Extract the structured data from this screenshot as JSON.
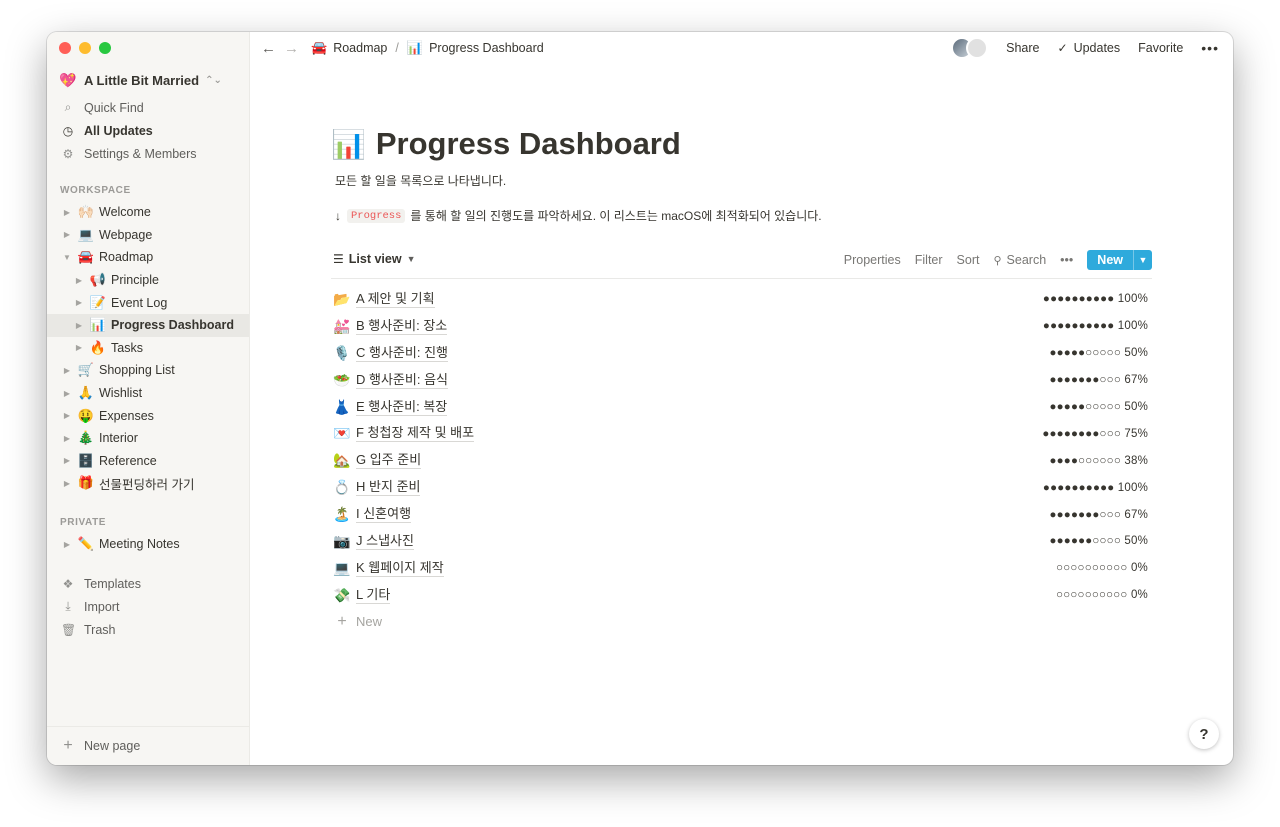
{
  "workspace": {
    "emoji": "💖",
    "name": "A Little Bit Married"
  },
  "sidebar": {
    "top_items": [
      {
        "icon": "search-icon",
        "glyph": "⌕",
        "label": "Quick Find"
      },
      {
        "icon": "clock-icon",
        "glyph": "◷",
        "label": "All Updates"
      },
      {
        "icon": "gear-icon",
        "glyph": "⚙",
        "label": "Settings & Members"
      }
    ],
    "workspace_label": "WORKSPACE",
    "workspace_pages": [
      {
        "emoji": "🙌🏻",
        "label": "Welcome"
      },
      {
        "emoji": "💻",
        "label": "Webpage"
      },
      {
        "emoji": "🚘",
        "label": "Roadmap"
      },
      {
        "emoji": "📢",
        "label": "Principle"
      },
      {
        "emoji": "📝",
        "label": "Event Log"
      },
      {
        "emoji": "📊",
        "label": "Progress Dashboard"
      },
      {
        "emoji": "🔥",
        "label": "Tasks"
      },
      {
        "emoji": "🛒",
        "label": "Shopping List"
      },
      {
        "emoji": "🙏",
        "label": "Wishlist"
      },
      {
        "emoji": "🤑",
        "label": "Expenses"
      },
      {
        "emoji": "🎄",
        "label": "Interior"
      },
      {
        "emoji": "🗄️",
        "label": "Reference"
      },
      {
        "emoji": "🎁",
        "label": "선물펀딩하러 가기"
      }
    ],
    "private_label": "PRIVATE",
    "private_pages": [
      {
        "emoji": "✏️",
        "label": "Meeting Notes"
      }
    ],
    "bottom_items": [
      {
        "icon": "templates-icon",
        "glyph": "❖",
        "label": "Templates"
      },
      {
        "icon": "import-icon",
        "glyph": "⤓",
        "label": "Import"
      },
      {
        "icon": "trash-icon",
        "glyph": "🗑",
        "label": "Trash"
      }
    ],
    "new_page": "New page"
  },
  "topbar": {
    "breadcrumb": [
      {
        "emoji": "🚘",
        "label": "Roadmap"
      },
      {
        "emoji": "📊",
        "label": "Progress Dashboard"
      }
    ],
    "separator": "/",
    "share": "Share",
    "updates": "Updates",
    "favorite": "Favorite"
  },
  "page": {
    "emoji": "📊",
    "title": "Progress Dashboard",
    "description": "모든 할 일을 목록으로 나타냅니다.",
    "hint_arrow": "↓",
    "hint_code": "Progress",
    "hint_text": "를 통해 할 일의 진행도를 파악하세요. 이 리스트는 macOS에 최적화되어 있습니다."
  },
  "view": {
    "name": "List view",
    "properties": "Properties",
    "filter": "Filter",
    "sort": "Sort",
    "search": "Search",
    "new": "New"
  },
  "items": [
    {
      "emoji": "📂",
      "name": "A 제안 및 기획",
      "progress": "●●●●●●●●●● 100%"
    },
    {
      "emoji": "💒",
      "name": "B 행사준비: 장소",
      "progress": "●●●●●●●●●● 100%"
    },
    {
      "emoji": "🎙️",
      "name": "C 행사준비: 진행",
      "progress": "●●●●●○○○○○ 50%"
    },
    {
      "emoji": "🥗",
      "name": "D 행사준비: 음식",
      "progress": "●●●●●●●○○○ 67%"
    },
    {
      "emoji": "👗",
      "name": "E 행사준비: 복장",
      "progress": "●●●●●○○○○○ 50%"
    },
    {
      "emoji": "💌",
      "name": "F 청첩장 제작 및 배포",
      "progress": "●●●●●●●●○○○ 75%"
    },
    {
      "emoji": "🏡",
      "name": "G 입주 준비",
      "progress": "●●●●○○○○○○ 38%"
    },
    {
      "emoji": "💍",
      "name": "H 반지 준비",
      "progress": "●●●●●●●●●● 100%"
    },
    {
      "emoji": "🏝️",
      "name": "I 신혼여행",
      "progress": "●●●●●●●○○○ 67%"
    },
    {
      "emoji": "📷",
      "name": "J 스냅사진",
      "progress": "●●●●●●○○○○ 50%"
    },
    {
      "emoji": "💻",
      "name": "K 웹페이지 제작",
      "progress": "○○○○○○○○○○ 0%"
    },
    {
      "emoji": "💸",
      "name": "L 기타",
      "progress": "○○○○○○○○○○ 0%"
    }
  ],
  "add_row_label": "New",
  "help": "?"
}
